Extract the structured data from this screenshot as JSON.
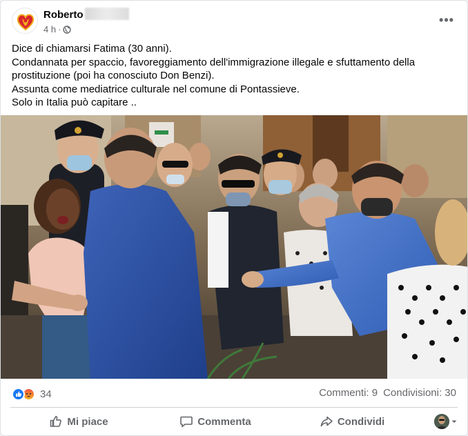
{
  "post": {
    "author": "Roberto",
    "time": "4 h",
    "separator": "·",
    "more_label": "•••",
    "text_lines": [
      "Dice di chiamarsi Fatima (30 anni).",
      "Condannata per spaccio, favoreggiamento dell'immigrazione illegale e  sfuttamento della",
      "prostituzione (poi ha conosciuto Don Benzi).",
      "Assunta come mediatrice culturale nel comune di Pontassieve.",
      "Solo in Italia può capitare .."
    ]
  },
  "reactions": {
    "count": "34",
    "types": [
      "like",
      "angry"
    ],
    "like_color": "#1877f2",
    "angry_color": "#f5533d"
  },
  "stats": {
    "comments": "Commenti: 9",
    "shares": "Condivisioni: 30"
  },
  "actions": {
    "like": "Mi piace",
    "comment": "Commenta",
    "share": "Condividi"
  },
  "colors": {
    "text_primary": "#050505",
    "text_secondary": "#65676b",
    "divider": "#ced0d4"
  }
}
